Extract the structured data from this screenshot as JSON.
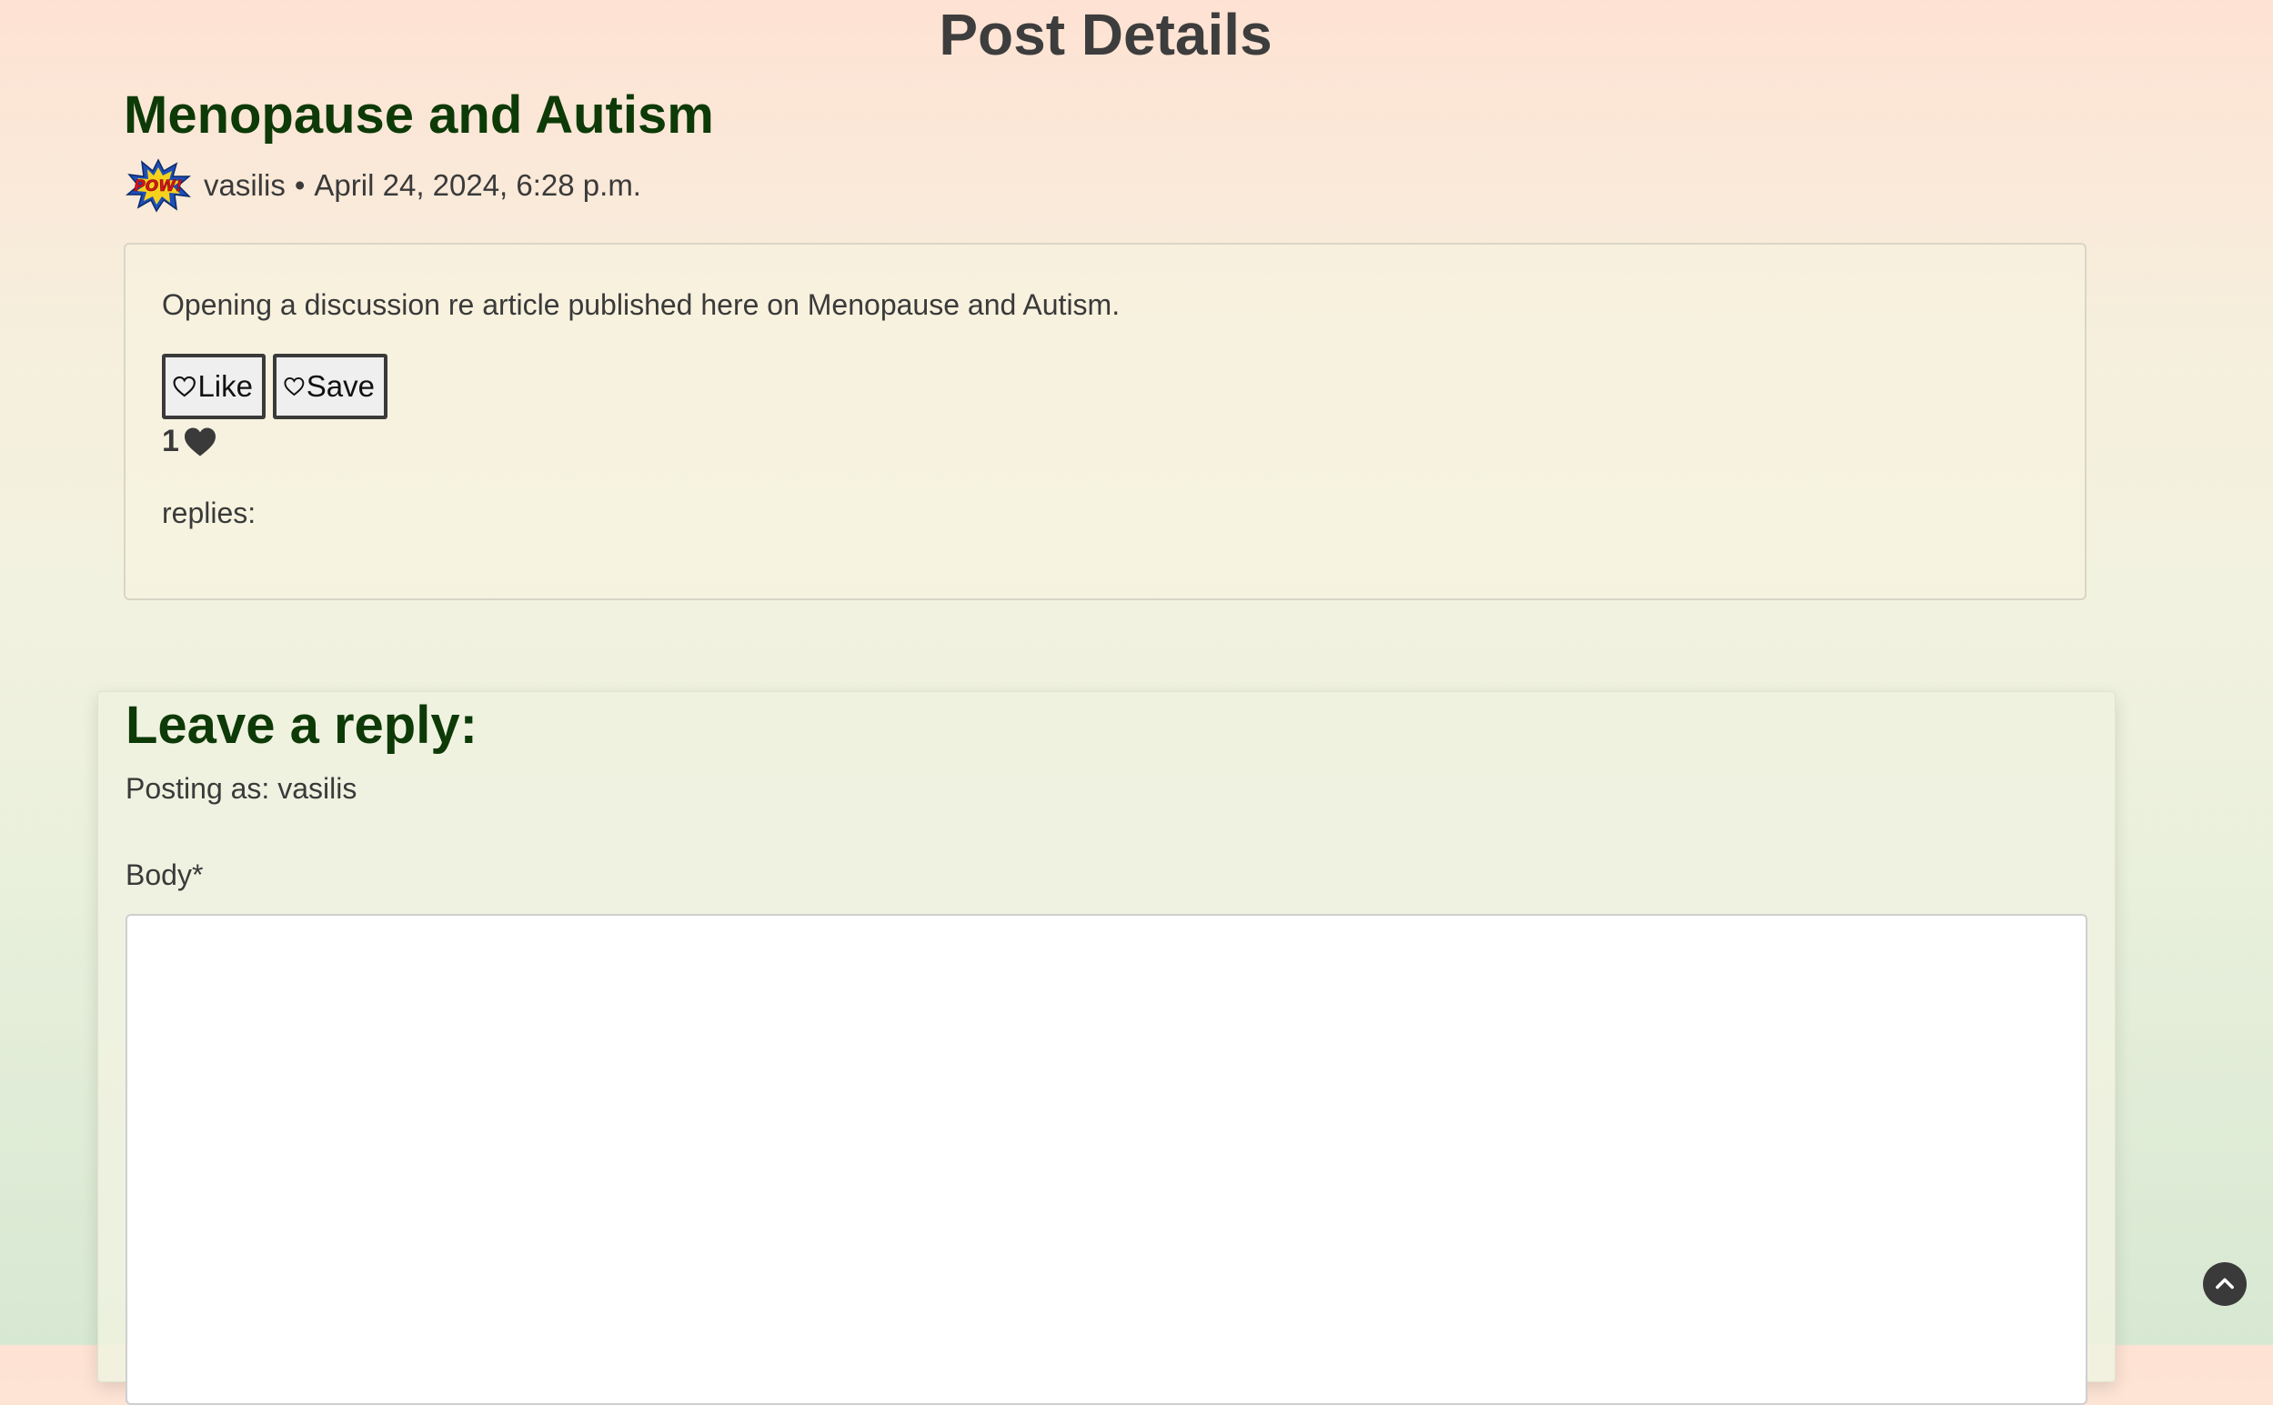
{
  "page": {
    "heading": "Post Details"
  },
  "post": {
    "title": "Menopause and Autism",
    "author": "vasilis",
    "separator": "•",
    "date": "April 24, 2024, 6:28 p.m.",
    "avatar_icon": "pow-comic-avatar-icon",
    "body": "Opening a discussion re article published here on Menopause and Autism.",
    "like_label": "Like",
    "save_label": "Save",
    "like_count": "1",
    "replies_label": "replies:"
  },
  "reply_form": {
    "heading": "Leave a reply:",
    "posting_as": "Posting as: vasilis",
    "body_label": "Body*",
    "body_value": ""
  },
  "icons": {
    "like_button_icon": "heart-outline-icon",
    "save_button_icon": "heart-outline-icon",
    "like_count_icon": "heart-filled-icon",
    "scroll_top_icon": "chevron-up-icon"
  },
  "colors": {
    "title": "#0d3a07",
    "text": "#3a3a3a",
    "bg_top": "#fee2d3",
    "bg_bottom": "#d7e8d2"
  }
}
